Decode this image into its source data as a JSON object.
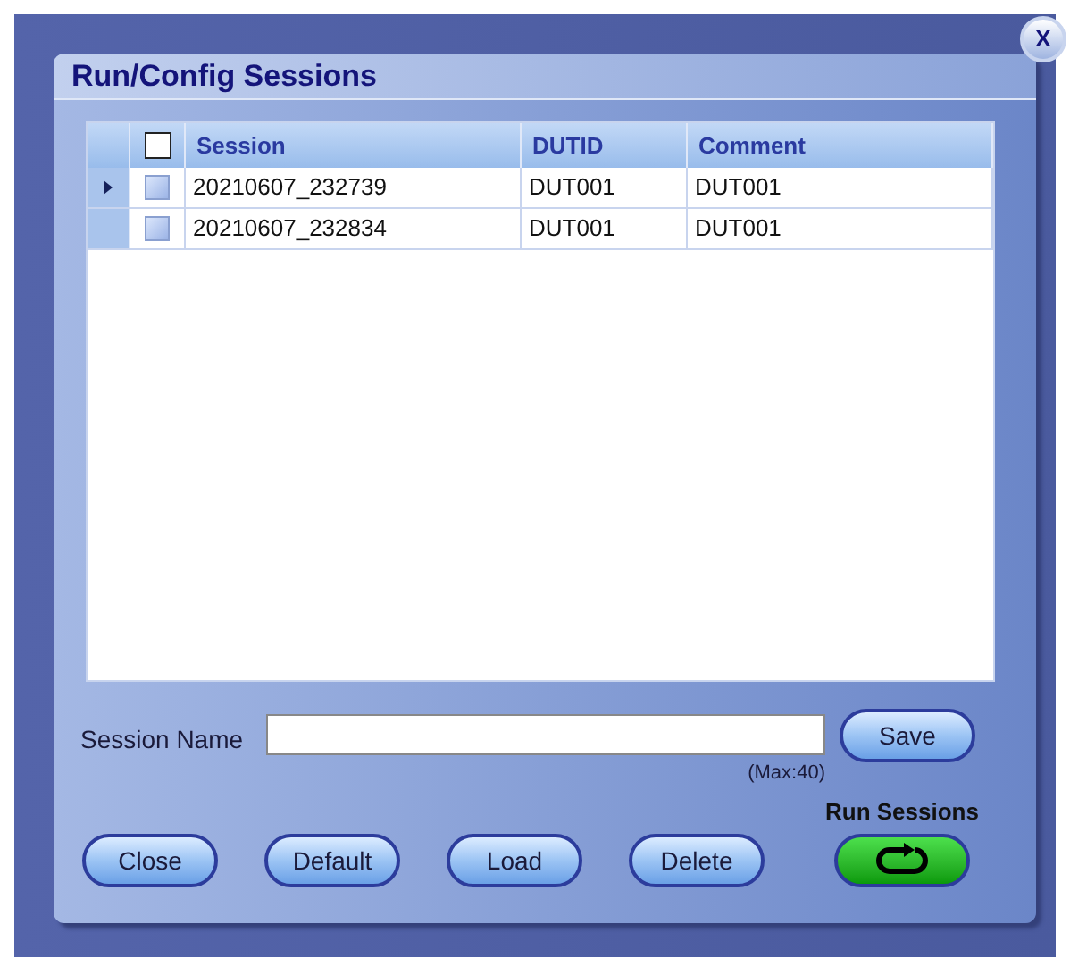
{
  "window": {
    "title": "Run/Config Sessions",
    "close_label": "X"
  },
  "table": {
    "header_checkbox": {
      "checked": false
    },
    "columns": [
      "Session",
      "DUTID",
      "Comment"
    ],
    "rows": [
      {
        "current": true,
        "checked": false,
        "cells": [
          "20210607_232739",
          "DUT001",
          "DUT001"
        ]
      },
      {
        "current": false,
        "checked": false,
        "cells": [
          "20210607_232834",
          "DUT001",
          "DUT001"
        ]
      }
    ]
  },
  "session_name": {
    "label": "Session Name",
    "hint": "(Max:40)",
    "save": "Save"
  },
  "run": {
    "label": "Run Sessions"
  },
  "buttons": [
    "Close",
    "Default",
    "Load",
    "Delete"
  ]
}
